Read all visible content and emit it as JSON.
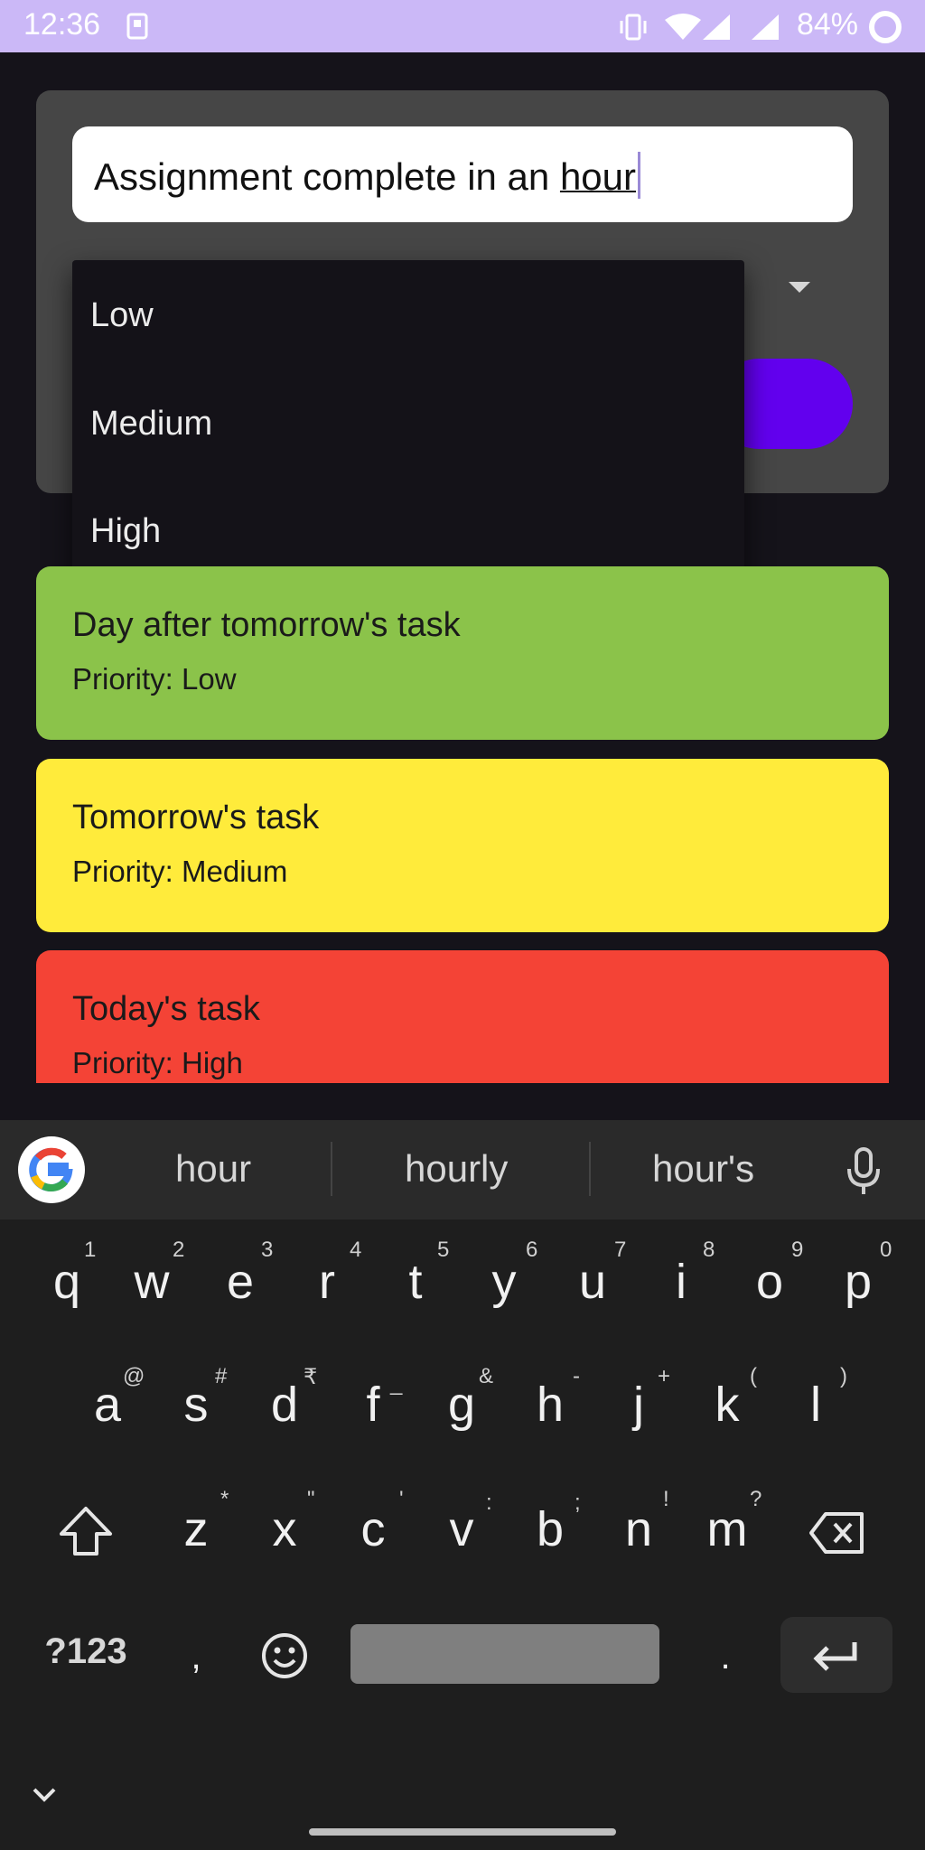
{
  "status_bar": {
    "time": "12:36",
    "battery": "84%"
  },
  "task_form": {
    "input_prefix": "Assignment complete in an ",
    "input_word": "hour"
  },
  "priority_menu": {
    "options": [
      "Low",
      "Medium",
      "High"
    ]
  },
  "tasks": [
    {
      "title": "Day after tomorrow's task",
      "priority": "Priority: Low",
      "color": "#8bc34a"
    },
    {
      "title": "Tomorrow's task",
      "priority": "Priority: Medium",
      "color": "#ffeb3b"
    },
    {
      "title": "Today's task",
      "priority": "Priority: High",
      "color": "#f44336"
    }
  ],
  "keyboard": {
    "suggestions": [
      "hour",
      "hourly",
      "hour's"
    ],
    "row1": [
      "q",
      "w",
      "e",
      "r",
      "t",
      "y",
      "u",
      "i",
      "o",
      "p"
    ],
    "row1_hints": [
      "1",
      "2",
      "3",
      "4",
      "5",
      "6",
      "7",
      "8",
      "9",
      "0"
    ],
    "row2": [
      "a",
      "s",
      "d",
      "f",
      "g",
      "h",
      "j",
      "k",
      "l"
    ],
    "row2_hints": [
      "@",
      "#",
      "₹",
      "_",
      "&",
      "-",
      "+",
      "(",
      ")"
    ],
    "row3": [
      "z",
      "x",
      "c",
      "v",
      "b",
      "n",
      "m"
    ],
    "row3_hints": [
      "*",
      "\"",
      "'",
      ":",
      ";",
      "!",
      "?"
    ],
    "symbols_label": "?123",
    "comma": ",",
    "period": "."
  }
}
